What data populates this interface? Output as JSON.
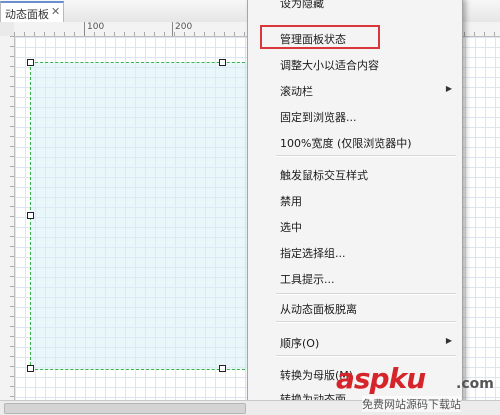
{
  "tab": {
    "label": "动态面板",
    "close": "✕"
  },
  "ruler": {
    "marks": [
      "100",
      "200"
    ]
  },
  "menu": {
    "items": [
      {
        "label": "设为隐藏"
      },
      {
        "label": "管理面板状态"
      },
      {
        "label": "调整大小以适合内容"
      },
      {
        "label": "滚动栏",
        "submenu": true
      },
      {
        "label": "固定到浏览器..."
      },
      {
        "label": "100%宽度 (仅限浏览器中)"
      },
      {
        "label": "触发鼠标交互样式"
      },
      {
        "label": "禁用"
      },
      {
        "label": "选中"
      },
      {
        "label": "指定选择组..."
      },
      {
        "label": "工具提示..."
      },
      {
        "label": "从动态面板脱离"
      },
      {
        "label": "顺序(O)",
        "submenu": true
      },
      {
        "label": "转换为母版(M)"
      },
      {
        "label": "转换为动态面"
      }
    ],
    "arrow": "▶"
  },
  "watermark": {
    "brand": "aspku",
    "tld": ".com",
    "sub": "免费网站源码下载站"
  },
  "colors": {
    "highlight": "#d9363e",
    "panel_border": "#3bb34a",
    "panel_fill": "#d7eef6",
    "brand": "#d6242b"
  }
}
